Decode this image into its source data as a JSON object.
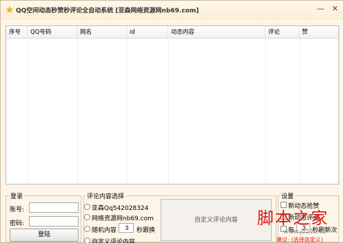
{
  "window": {
    "title": "QQ空间动态秒赞秒评论全自动系统   [亚森网络资源网nb69.com]",
    "minimize_glyph": "—",
    "close_glyph": "✕"
  },
  "table": {
    "columns": [
      "序号",
      "QQ号码",
      "网名",
      "id",
      "动态内容",
      "评论",
      "赞"
    ],
    "rows": []
  },
  "login": {
    "group_title": "登录",
    "account_label": "账号:",
    "account_value": "",
    "password_label": "密码:",
    "password_value": "",
    "login_button": "登陆"
  },
  "comment": {
    "group_title": "评论内容选择",
    "option1": "亚森Qq542028324",
    "option2": "网络资源网nb69.com",
    "option3_prefix": "随机内容",
    "option3_value": "3",
    "option3_suffix": "秒跟换",
    "option4": "自定义评论内容",
    "custom_area_label": "自定义评论内容"
  },
  "settings": {
    "group_title": "设置",
    "opt1": "新动态抢赞",
    "opt2": "新动态评论",
    "opt3_prefix": "每",
    "opt3_value": "3",
    "opt3_suffix": "秒刷新次",
    "hint": "建议: (选择自定义)"
  },
  "watermark": {
    "main": "脚本之家",
    "url": "www.jb51.net"
  },
  "colors": {
    "background": "#fdf5e8",
    "accent_red": "#e01818"
  }
}
